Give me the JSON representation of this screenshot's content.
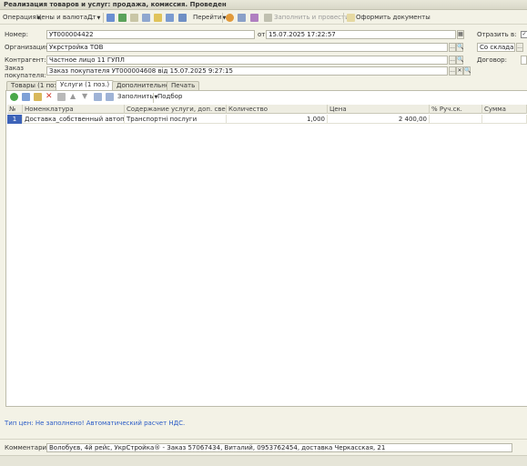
{
  "window": {
    "title": "Реализация товаров и услуг: продажа, комиссия. Проведен"
  },
  "toolbar": {
    "operation": "Операция",
    "prices": "Цены и валюта...",
    "dt": "Дт",
    "goto": "Перейти",
    "fill_post": "Заполнить и провести",
    "make_docs": "Оформить документы"
  },
  "header": {
    "number_label": "Номер:",
    "number": "УТ000004422",
    "date_label": "от:",
    "date": "15.07.2025 17:22:57",
    "reflect_label": "Отразить в:",
    "org_label": "Организация:",
    "org": "Укрстройка ТОВ",
    "warehouse": "Со склада",
    "contractor_label": "Контрагент:",
    "contractor": "Частное лицо 11 ГУПЛ",
    "contract_label": "Договор:",
    "order_label_1": "Заказ",
    "order_label_2": "покупателя:",
    "order": "Заказ покупателя УТ000004608 від 15.07.2025 9:27:15"
  },
  "tabs": [
    {
      "label": "Товары (1 поз.)"
    },
    {
      "label": "Услуги (1 поз.)"
    },
    {
      "label": "Дополнительно"
    },
    {
      "label": "Печать"
    }
  ],
  "table_toolbar": {
    "fill": "Заполнить",
    "select": "Подбор"
  },
  "table": {
    "columns": [
      "№",
      "Номенклатура",
      "Содержание услуги, доп. сведения",
      "Количество",
      "Цена",
      "% Руч.ск.",
      "Сумма"
    ],
    "rows": [
      {
        "n": "1",
        "item": "Доставка_собственный автопарк",
        "content": "Транспортні послуги",
        "qty": "1,000",
        "price": "2 400,00",
        "disc": "",
        "sum": ""
      }
    ]
  },
  "footer": {
    "price_type": "Тип цен: Не заполнено! Автоматический расчет НДС.",
    "comment_label": "Комментарий:",
    "comment": "Волобуєв, 4й рейс, УкрСтройка® - Заказ 57067434, Виталий, 0953762454, доставка Черкасская, 21"
  },
  "colors": {
    "accent": "#3d63b8",
    "link": "#2a5bc6",
    "background": "#f3f2e6"
  }
}
